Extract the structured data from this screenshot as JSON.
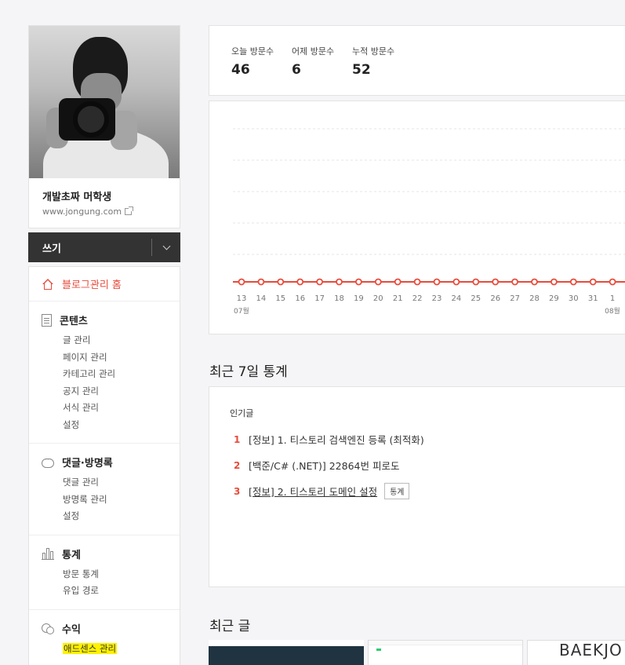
{
  "profile": {
    "blog_name": "개발초짜 머학생",
    "blog_url": "www.jongung.com"
  },
  "write": {
    "label": "쓰기"
  },
  "menu": {
    "home": "블로그관리 홈",
    "sections": [
      {
        "title": "콘텐츠",
        "icon": "document-icon",
        "items": [
          "글 관리",
          "페이지 관리",
          "카테고리 관리",
          "공지 관리",
          "서식 관리",
          "설정"
        ]
      },
      {
        "title": "댓글·방명록",
        "icon": "chat-bubble-icon",
        "items": [
          "댓글 관리",
          "방명록 관리",
          "설정"
        ]
      },
      {
        "title": "통계",
        "icon": "bar-chart-icon",
        "items": [
          "방문 통계",
          "유입 경로"
        ]
      },
      {
        "title": "수익",
        "icon": "coins-icon",
        "items": [
          "애드센스 관리"
        ]
      }
    ]
  },
  "visits": {
    "today_label": "오늘 방문수",
    "today_value": "46",
    "yesterday_label": "어제 방문수",
    "yesterday_value": "6",
    "total_label": "누적 방문수",
    "total_value": "52"
  },
  "chart_data": {
    "type": "line",
    "x": [
      "13",
      "14",
      "15",
      "16",
      "17",
      "18",
      "19",
      "20",
      "21",
      "22",
      "23",
      "24",
      "25",
      "26",
      "27",
      "28",
      "29",
      "30",
      "31",
      "1"
    ],
    "values": [
      0,
      0,
      0,
      0,
      0,
      0,
      0,
      0,
      0,
      0,
      0,
      0,
      0,
      0,
      0,
      0,
      0,
      0,
      0,
      0
    ],
    "month_labels": [
      {
        "at": "13",
        "label": "07월"
      },
      {
        "at": "1",
        "label": "08월"
      }
    ],
    "grid": true,
    "color": "#e74c3c"
  },
  "recent7": {
    "title": "최근 7일 통계",
    "popular_label": "인기글",
    "items": [
      {
        "rank": "1",
        "text": "[정보] 1. 티스토리 검색엔진 등록 (최적화)"
      },
      {
        "rank": "2",
        "text": "[백준/C# (.NET)] 22864번 피로도"
      },
      {
        "rank": "3",
        "text": "[정보] 2. 티스토리 도메인 설정",
        "button": "통계"
      }
    ]
  },
  "recent_posts": {
    "title": "최근 글",
    "thumb3_text": "BAEKJO"
  }
}
